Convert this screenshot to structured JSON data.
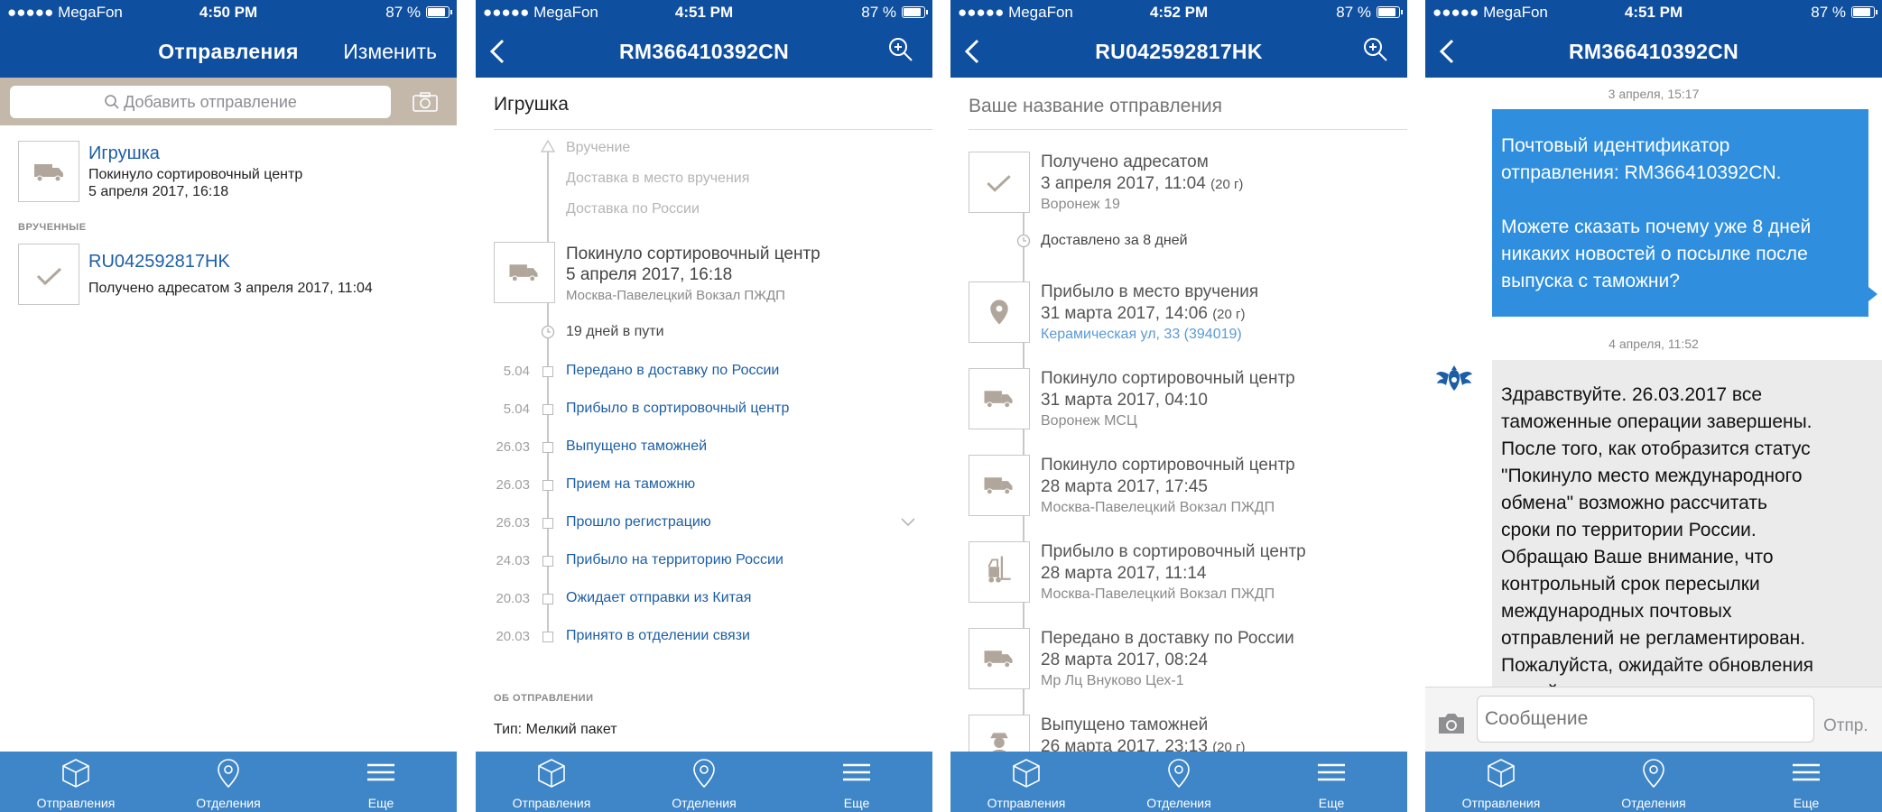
{
  "status_bars": [
    {
      "carrier": "●●●●● MegaFon",
      "time": "4:50 PM",
      "battery": "87 %"
    },
    {
      "carrier": "●●●●● MegaFon",
      "time": "4:51 PM",
      "battery": "87 %"
    },
    {
      "carrier": "●●●●● MegaFon",
      "time": "4:52 PM",
      "battery": "87 %"
    },
    {
      "carrier": "●●●●● MegaFon",
      "time": "4:51 PM",
      "battery": "87 %"
    }
  ],
  "tabbar": {
    "shipments": "Отправления",
    "offices": "Отделения",
    "more": "Еще"
  },
  "screen1": {
    "title": "Отправления",
    "edit": "Изменить",
    "search_placeholder": "Добавить отправление",
    "items": [
      {
        "name": "Игрушка",
        "status": "Покинуло сортировочный центр",
        "date": "5 апреля 2017, 16:18"
      },
      {
        "name": "RU042592817HK",
        "status": "Получено адресатом 3 апреля 2017, 11:04"
      }
    ],
    "section_delivered": "ВРУЧЕННЫЕ"
  },
  "screen2": {
    "title": "RM366410392CN",
    "name": "Игрушка",
    "future": [
      "Вручение",
      "Доставка в место вручения",
      "Доставка по России"
    ],
    "current": {
      "title": "Покинуло сортировочный центр",
      "date": "5 апреля 2017, 16:18",
      "place": "Москва-Павелецкий Вокзал ПЖДП"
    },
    "transit": "19 дней в пути",
    "history": [
      {
        "date": "5.04",
        "label": "Передано в доставку по России"
      },
      {
        "date": "5.04",
        "label": "Прибыло в сортировочный центр"
      },
      {
        "date": "26.03",
        "label": "Выпущено таможней"
      },
      {
        "date": "26.03",
        "label": "Прием на таможню"
      },
      {
        "date": "26.03",
        "label": "Прошло регистрацию"
      },
      {
        "date": "24.03",
        "label": "Прибыло на территорию России"
      },
      {
        "date": "20.03",
        "label": "Ожидает отправки из Китая"
      },
      {
        "date": "20.03",
        "label": "Принято в отделении связи"
      }
    ],
    "about_header": "ОБ ОТПРАВЛЕНИИ",
    "type": "Тип: Мелкий пакет"
  },
  "screen3": {
    "title": "RU042592817HK",
    "name_placeholder": "Ваше название отправления",
    "events": [
      {
        "title": "Получено адресатом",
        "date": "3 апреля 2017, 11:04",
        "weight": "(20 г)",
        "sub": "Воронеж 19",
        "icon": "check-icon"
      },
      {
        "title": "Прибыло в место вручения",
        "date": "31 марта 2017, 14:06",
        "weight": "(20 г)",
        "sub": "Керамическая ул, 33 (394019)",
        "icon": "location-pin-icon"
      },
      {
        "title": "Покинуло сортировочный центр",
        "date": "31 марта 2017, 04:10",
        "weight": "",
        "sub": "Воронеж МСЦ",
        "icon": "truck-icon"
      },
      {
        "title": "Покинуло сортировочный центр",
        "date": "28 марта 2017, 17:45",
        "weight": "",
        "sub": "Москва-Павелецкий Вокзал ПЖДП",
        "icon": "truck-icon"
      },
      {
        "title": "Прибыло в сортировочный центр",
        "date": "28 марта 2017, 11:14",
        "weight": "",
        "sub": "Москва-Павелецкий Вокзал ПЖДП",
        "icon": "forklift-icon"
      },
      {
        "title": "Передано в доставку по России",
        "date": "28 марта 2017, 08:24",
        "weight": "",
        "sub": "Мр Лц Внуково Цех-1",
        "icon": "truck-icon"
      },
      {
        "title": "Выпущено таможней",
        "date": "26 марта 2017, 23:13",
        "weight": "(20 г)",
        "sub": "",
        "icon": "customs-officer-icon"
      }
    ],
    "delivered_in": "Доставлено за 8 дней"
  },
  "screen4": {
    "title": "RM366410392CN",
    "ts1": "3 апреля, 15:17",
    "msg1": [
      "Почтовый идентификатор",
      "отправления: RM366410392CN.",
      "",
      "Можете сказать почему уже 8 дней",
      "никаких новостей о посылке после",
      "выпуска с таможни?"
    ],
    "ts2": "4 апреля, 11:52",
    "msg2": [
      "Здравствуйте. 26.03.2017 все",
      "таможенные операции завершены.",
      "После того, как отобразится статус",
      "\"Покинуло место международного",
      "обмена\" возможно рассчитать",
      "сроки по территории России.",
      "Обращаю Ваше внимание, что",
      "контрольный срок пересылки",
      "международных почтовых",
      "отправлений не регламентирован.",
      "Пожалуйста, ожидайте обновления",
      "на сайте."
    ],
    "input_placeholder": "Сообщение",
    "send": "Отпр."
  },
  "colors": {
    "nav": "#0f4fa0",
    "tabbar": "#3f86c8",
    "link": "#1c5ea6",
    "bubble_out": "#2f8fde",
    "bubble_in": "#ebebeb"
  }
}
